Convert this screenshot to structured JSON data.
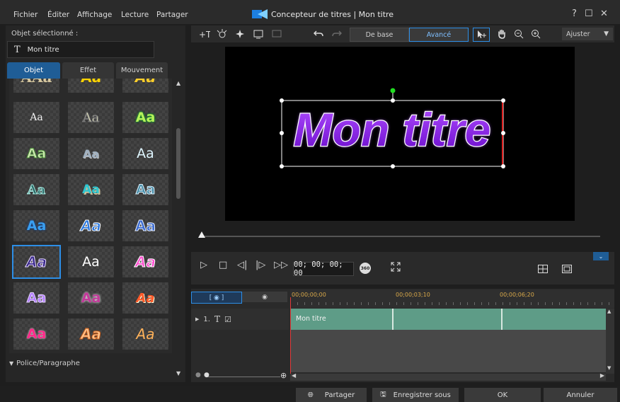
{
  "menu": [
    "Fichier",
    "Éditer",
    "Affichage",
    "Lecture",
    "Partager"
  ],
  "window": {
    "title": "Concepteur de titres  |  Mon titre",
    "help": "?",
    "maximize": "☐",
    "close": "✕"
  },
  "left": {
    "selected_label": "Objet sélectionné :",
    "title_icon": "T",
    "title_value": "Mon titre",
    "tabs": [
      "Objet",
      "Effet",
      "Mouvement"
    ],
    "active_tab": "Objet",
    "presets": [
      "AAa",
      "Aa",
      "Aa",
      "Aa",
      "Aa",
      "Aa",
      "Aa",
      "Aa",
      "Aa",
      "Aa",
      "Aa",
      "Aa",
      "Aa",
      "Aa",
      "Aa",
      "Aa",
      "Aa",
      "Aa",
      "Aa",
      "Aa",
      "Aa",
      "Aa",
      "Aa",
      "Aa"
    ],
    "police_label": "Police/Paragraphe"
  },
  "toolbar": {
    "mode_basic": "De base",
    "mode_advanced": "Avancé",
    "fit": "Ajuster"
  },
  "preview": {
    "text": "Mon titre"
  },
  "controls": {
    "timecode": "00; 00; 00; 00"
  },
  "timeline": {
    "ruler": [
      "00;00;00;00",
      "00;00;03;10",
      "00;00;06;20"
    ],
    "track_label": "1.",
    "track_icon": "T",
    "clip_label": "Mon titre"
  },
  "footer": {
    "share": "Partager",
    "save_as": "Enregistrer sous",
    "ok": "OK",
    "cancel": "Annuler"
  }
}
